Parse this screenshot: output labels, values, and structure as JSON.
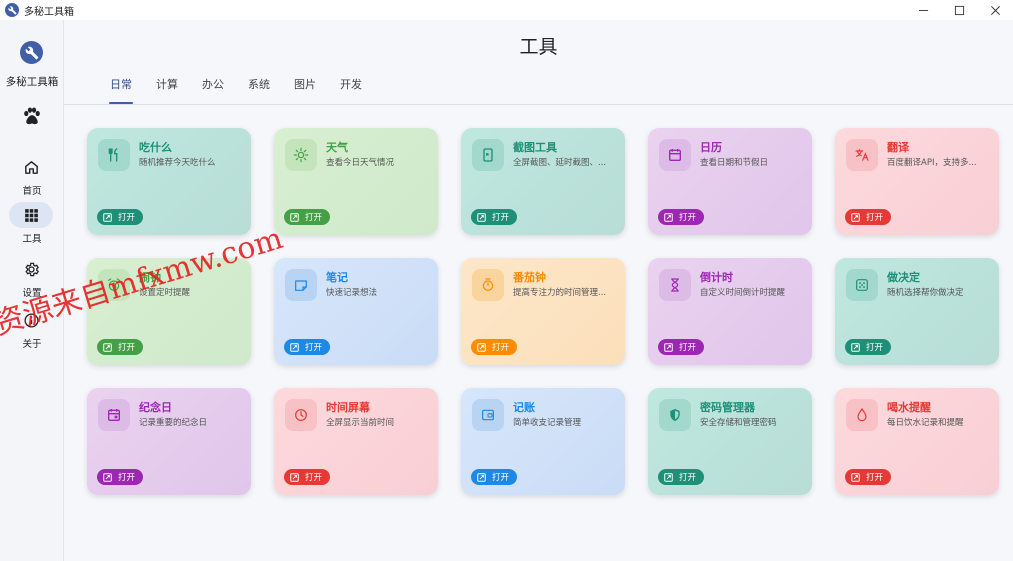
{
  "window": {
    "title": "多秘工具箱"
  },
  "sidebar": {
    "brand": "多秘工具箱",
    "items": [
      {
        "label": "首页",
        "icon": "home-icon"
      },
      {
        "label": "工具",
        "icon": "grid-icon"
      },
      {
        "label": "设置",
        "icon": "gear-icon"
      },
      {
        "label": "关于",
        "icon": "info-icon"
      }
    ]
  },
  "main": {
    "title": "工具",
    "tabs": [
      "日常",
      "计算",
      "办公",
      "系统",
      "图片",
      "开发"
    ],
    "active_tab": "日常",
    "open_label": "打开",
    "cards": [
      {
        "title": "吃什么",
        "desc": "随机推荐今天吃什么",
        "color": "#1f8f78",
        "icon": "utensils-icon"
      },
      {
        "title": "天气",
        "desc": "查看今日天气情况",
        "color": "#43a047",
        "icon": "sun-icon"
      },
      {
        "title": "截图工具",
        "desc": "全屏截图、延时截图、...",
        "color": "#1f8f78",
        "icon": "screenshot-icon"
      },
      {
        "title": "日历",
        "desc": "查看日期和节假日",
        "color": "#9c27b0",
        "icon": "calendar-icon"
      },
      {
        "title": "翻译",
        "desc": "百度翻译API，支持多...",
        "color": "#e53935",
        "icon": "translate-icon"
      },
      {
        "title": "闹钟",
        "desc": "设置定时提醒",
        "color": "#43a047",
        "icon": "alarm-icon"
      },
      {
        "title": "笔记",
        "desc": "快速记录想法",
        "color": "#1e88e5",
        "icon": "note-icon"
      },
      {
        "title": "番茄钟",
        "desc": "提高专注力的时间管理...",
        "color": "#fb8c00",
        "icon": "timer-icon"
      },
      {
        "title": "倒计时",
        "desc": "自定义时间倒计时提醒",
        "color": "#9c27b0",
        "icon": "hourglass-icon"
      },
      {
        "title": "做决定",
        "desc": "随机选择帮你做决定",
        "color": "#1f8f78",
        "icon": "dice-icon"
      },
      {
        "title": "纪念日",
        "desc": "记录重要的纪念日",
        "color": "#9c27b0",
        "icon": "event-icon"
      },
      {
        "title": "时间屏幕",
        "desc": "全屏显示当前时间",
        "color": "#e53935",
        "icon": "clock-icon"
      },
      {
        "title": "记账",
        "desc": "简单收支记录管理",
        "color": "#1e88e5",
        "icon": "wallet-icon"
      },
      {
        "title": "密码管理器",
        "desc": "安全存储和管理密码",
        "color": "#1f8f78",
        "icon": "shield-icon"
      },
      {
        "title": "喝水提醒",
        "desc": "每日饮水记录和提醒",
        "color": "#e53935",
        "icon": "water-drop-icon"
      }
    ]
  },
  "watermark": "资源来自mfxmw.com"
}
